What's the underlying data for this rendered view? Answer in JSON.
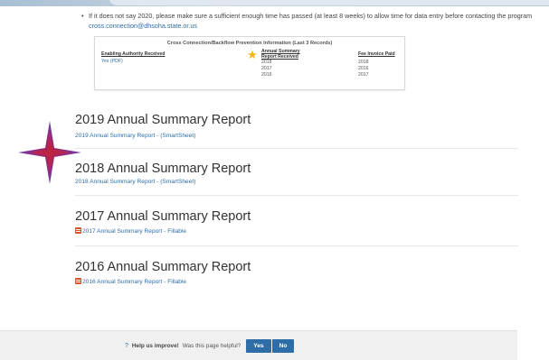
{
  "notice": {
    "bullet": "•",
    "text": "If it does not say 2020, please make sure a sufficient enough time has passed (at least 8 weeks) to allow time for data entry before contacting the program",
    "email": "cross.connection@dhsoha.state.or.us"
  },
  "info_box": {
    "title": "Cross Connection/Backflow Prevention Information (Last 3 Records)",
    "headers": [
      "Enabling Authority Received",
      "Annual Summary Report Received",
      "Fee Invoice Paid"
    ],
    "authority_value": "Yes (PDF)",
    "report_years": [
      "2018",
      "2017",
      "2016"
    ],
    "fee_years": [
      "2018",
      "2016",
      "2017"
    ],
    "star_color": "#f2b705"
  },
  "sections": [
    {
      "title": "2019 Annual Summary Report",
      "link": "2019 Annual Summary Report - (SmartSheet)",
      "pdf": false
    },
    {
      "title": "2018 Annual Summary Report",
      "link": "2018 Annual Summary Report - (SmartSheet)",
      "pdf": false
    },
    {
      "title": "2017 Annual Summary Report",
      "link": "2017 Annual Summary Report - Fillable",
      "pdf": true
    },
    {
      "title": "2016 Annual Summary Report",
      "link": "2016 Annual Summary Report - Fillable",
      "pdf": true
    }
  ],
  "feedback": {
    "icon": "question-icon",
    "prompt_bold": "Help us improve!",
    "prompt": "Was this page helpful?",
    "yes": "Yes",
    "no": "No"
  },
  "colors": {
    "link": "#2d6ea8",
    "button": "#2d6ea8",
    "pdf_icon": "#d9532c",
    "sparkle": "#8a2f8f"
  }
}
